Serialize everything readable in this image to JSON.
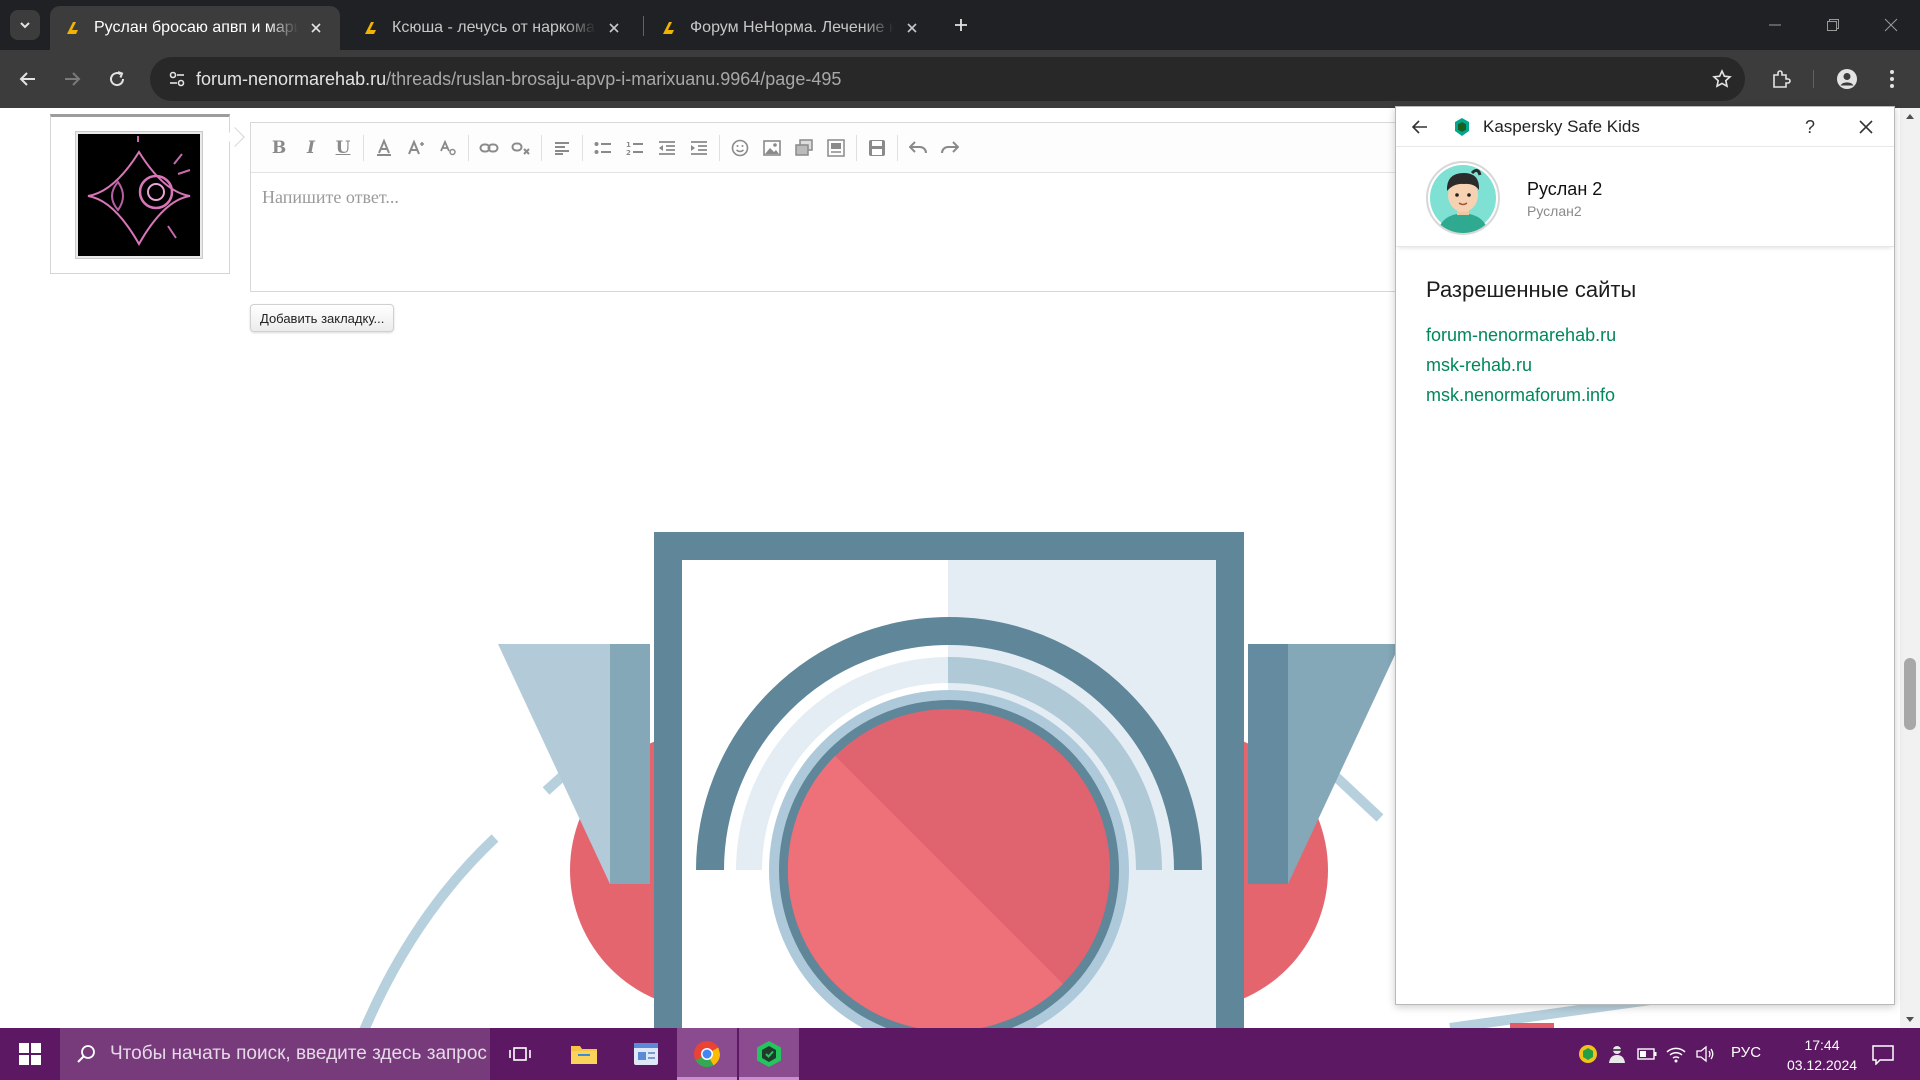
{
  "browser": {
    "tabs": [
      {
        "title": "Руслан бросаю апвп и марихуану",
        "active": true
      },
      {
        "title": "Ксюша - лечусь от наркомании",
        "active": false
      },
      {
        "title": "Форум НеНорма. Лечение наркомании",
        "active": false
      }
    ],
    "url_host": "forum-nenormarehab.ru",
    "url_path": "/threads/ruslan-brosaju-apvp-i-marixuanu.9964/page-495"
  },
  "page": {
    "editor_placeholder": "Напишите ответ...",
    "bookmark_button": "Добавить закладку..."
  },
  "kaspersky": {
    "title": "Kaspersky Safe Kids",
    "help": "?",
    "child_name": "Руслан 2",
    "child_account": "Руслан2",
    "section_title": "Разрешенные сайты",
    "allowed_sites": [
      "forum-nenormarehab.ru",
      "msk-rehab.ru",
      "msk.nenormaforum.info"
    ]
  },
  "taskbar": {
    "search_placeholder": "Чтобы начать поиск, введите здесь запрос",
    "language": "РУС",
    "time": "17:44",
    "date": "03.12.2024"
  },
  "colors": {
    "tab_strip": "#202124",
    "toolbar": "#3c3c3c",
    "kaspersky_link": "#00875a",
    "taskbar": "#5c1862"
  }
}
